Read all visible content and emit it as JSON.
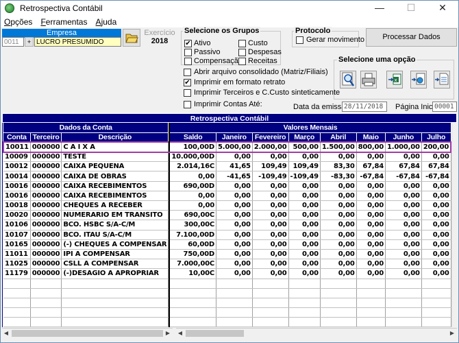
{
  "window": {
    "title": "Retrospectiva Contábil",
    "min": "—",
    "max": "☐",
    "close": "✕"
  },
  "menu": [
    {
      "ul": "O",
      "rest": "pções"
    },
    {
      "ul": "F",
      "rest": "erramentas"
    },
    {
      "ul": "A",
      "rest": "juda"
    }
  ],
  "empresa": {
    "label": "Empresa",
    "code": "0011",
    "name": "LUCRO PRESUMIDO"
  },
  "exercicio": {
    "label": "Exercício",
    "value": "2018"
  },
  "grupos": {
    "title": "Selecione os Grupos",
    "items": [
      {
        "label": "Ativo",
        "checked": "✔"
      },
      {
        "label": "Passivo",
        "checked": ""
      },
      {
        "label": "Compensação",
        "checked": ""
      },
      {
        "label": "Custo",
        "checked": ""
      },
      {
        "label": "Despesas",
        "checked": ""
      },
      {
        "label": "Receitas",
        "checked": ""
      }
    ]
  },
  "protocolo": {
    "title": "Protocolo",
    "gerar": "Gerar movimento"
  },
  "processar": "Processar Dados",
  "opcao": {
    "title": "Selecione uma opção"
  },
  "options": [
    {
      "label": "Abrir arquivo consolidado (Matriz/Filiais)",
      "checked": ""
    },
    {
      "label": "Imprimir em formato retrato",
      "checked": "✔"
    },
    {
      "label": "Imprimir Terceiros e C.Custo sinteticamente",
      "checked": ""
    },
    {
      "label": "Imprimir Contas Até:",
      "checked": ""
    }
  ],
  "data_emissao": {
    "label": "Data da emissão:",
    "value": "28/11/2018"
  },
  "pagina_inicial": {
    "label": "Página Inicial",
    "value": "00001"
  },
  "grid": {
    "title": "Retrospectiva Contábil",
    "group_conta": "Dados da Conta",
    "group_valores": "Valores Mensais",
    "columns": [
      "Conta",
      "Terceiro",
      "Descrição",
      "Saldo",
      "Janeiro",
      "Fevereiro",
      "Março",
      "Abril",
      "Maio",
      "Junho",
      "Julho"
    ],
    "rows": [
      [
        "10011",
        "000000",
        "C A I X A",
        "100,00D",
        "5.000,00",
        "2.000,00",
        "500,00",
        "1.500,00",
        "800,00",
        "1.000,00",
        "200,00"
      ],
      [
        "10009",
        "000000",
        "TESTE",
        "10.000,00D",
        "0,00",
        "0,00",
        "0,00",
        "0,00",
        "0,00",
        "0,00",
        "0,00"
      ],
      [
        "10012",
        "000000",
        "CAIXA PEQUENA",
        "2.014,16C",
        "41,65",
        "109,49",
        "109,49",
        "83,30",
        "67,84",
        "67,84",
        "67,84"
      ],
      [
        "10014",
        "000000",
        "CAIXA DE OBRAS",
        "0,00",
        "-41,65",
        "-109,49",
        "-109,49",
        "-83,30",
        "-67,84",
        "-67,84",
        "-67,84"
      ],
      [
        "10016",
        "000000",
        "CAIXA RECEBIMENTOS",
        "690,00D",
        "0,00",
        "0,00",
        "0,00",
        "0,00",
        "0,00",
        "0,00",
        "0,00"
      ],
      [
        "10016",
        "000000",
        "CAIXA RECEBIMENTOS",
        "0,00",
        "0,00",
        "0,00",
        "0,00",
        "0,00",
        "0,00",
        "0,00",
        "0,00"
      ],
      [
        "10018",
        "000000",
        "CHEQUES A RECEBER",
        "0,00",
        "0,00",
        "0,00",
        "0,00",
        "0,00",
        "0,00",
        "0,00",
        "0,00"
      ],
      [
        "10020",
        "000000",
        "NUMERARIO EM TRANSITO",
        "690,00C",
        "0,00",
        "0,00",
        "0,00",
        "0,00",
        "0,00",
        "0,00",
        "0,00"
      ],
      [
        "10106",
        "000000",
        "BCO. HSBC S/A-C/M",
        "300,00C",
        "0,00",
        "0,00",
        "0,00",
        "0,00",
        "0,00",
        "0,00",
        "0,00"
      ],
      [
        "10107",
        "000000",
        "BCO. ITAU S/A-C/M",
        "7.100,00D",
        "0,00",
        "0,00",
        "0,00",
        "0,00",
        "0,00",
        "0,00",
        "0,00"
      ],
      [
        "10165",
        "000000",
        "(-) CHEQUES A COMPENSAR",
        "60,00D",
        "0,00",
        "0,00",
        "0,00",
        "0,00",
        "0,00",
        "0,00",
        "0,00"
      ],
      [
        "11011",
        "000000",
        "IPI A COMPENSAR",
        "750,00D",
        "0,00",
        "0,00",
        "0,00",
        "0,00",
        "0,00",
        "0,00",
        "0,00"
      ],
      [
        "11025",
        "000000",
        "CSLL A COMPENSAR",
        "7.000,00C",
        "0,00",
        "0,00",
        "0,00",
        "0,00",
        "0,00",
        "0,00",
        "0,00"
      ],
      [
        "11179",
        "000000",
        "(-)DESAGIO A APROPRIAR",
        "10,00C",
        "0,00",
        "0,00",
        "0,00",
        "0,00",
        "0,00",
        "0,00",
        "0,00"
      ]
    ],
    "empty_rows": 5
  },
  "colors": {
    "header_bg": "#000080",
    "selection_outline": "#a03aa8",
    "empresa_label_bg": "#0078d7",
    "field_yellow": "#ffffc0"
  }
}
